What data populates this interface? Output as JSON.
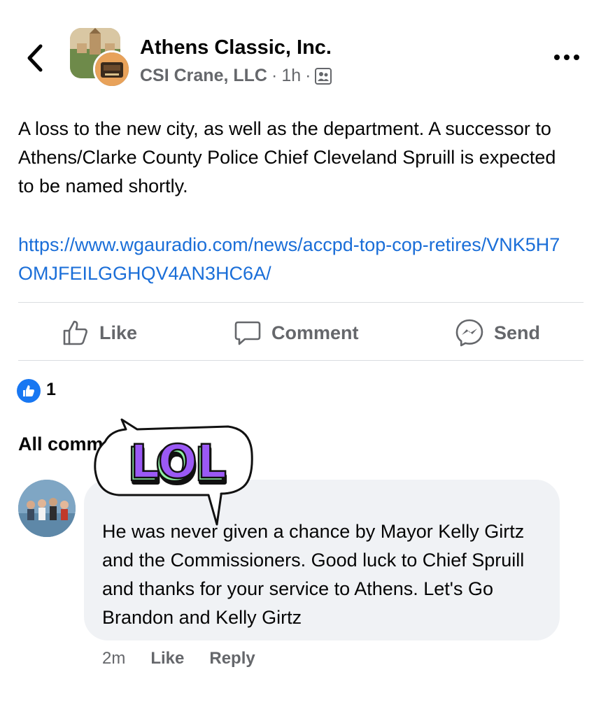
{
  "header": {
    "title": "Athens Classic, Inc.",
    "subtitle": "CSI Crane, LLC",
    "time": "1h",
    "separator": "·",
    "icons": [
      "chevron-left-icon",
      "more-dots-icon",
      "group-members-icon"
    ]
  },
  "post": {
    "text": "A loss to the new city, as well as the department.  A successor to Athens/Clarke County Police Chief Cleveland Spruill is expected to be named shortly.",
    "link": "https://www.wgauradio.com/news/accpd-top-cop-retires/VNK5H7OMJFEILGGHQV4AN3HC6A/"
  },
  "actions": {
    "like_label": "Like",
    "comment_label": "Comment",
    "send_label": "Send"
  },
  "reactions": {
    "count": "1",
    "icon": "thumbs-up-icon"
  },
  "comments": {
    "header": "All comments",
    "items": [
      {
        "text": "He was never given a chance by Mayor Kelly Girtz and the Commissioners. Good luck to Chief Spruill and thanks for your service to Athens. Let's Go Brandon and Kelly Girtz",
        "time": "2m",
        "like_label": "Like",
        "reply_label": "Reply"
      }
    ]
  },
  "sticker": {
    "text": "LOL",
    "fill_color": "#9b59f5",
    "shadow_color": "#8ff0a4"
  },
  "colors": {
    "link": "#1a6ed8",
    "muted": "#65676b",
    "like_blue": "#1877f2",
    "bubble": "#f0f2f5"
  }
}
